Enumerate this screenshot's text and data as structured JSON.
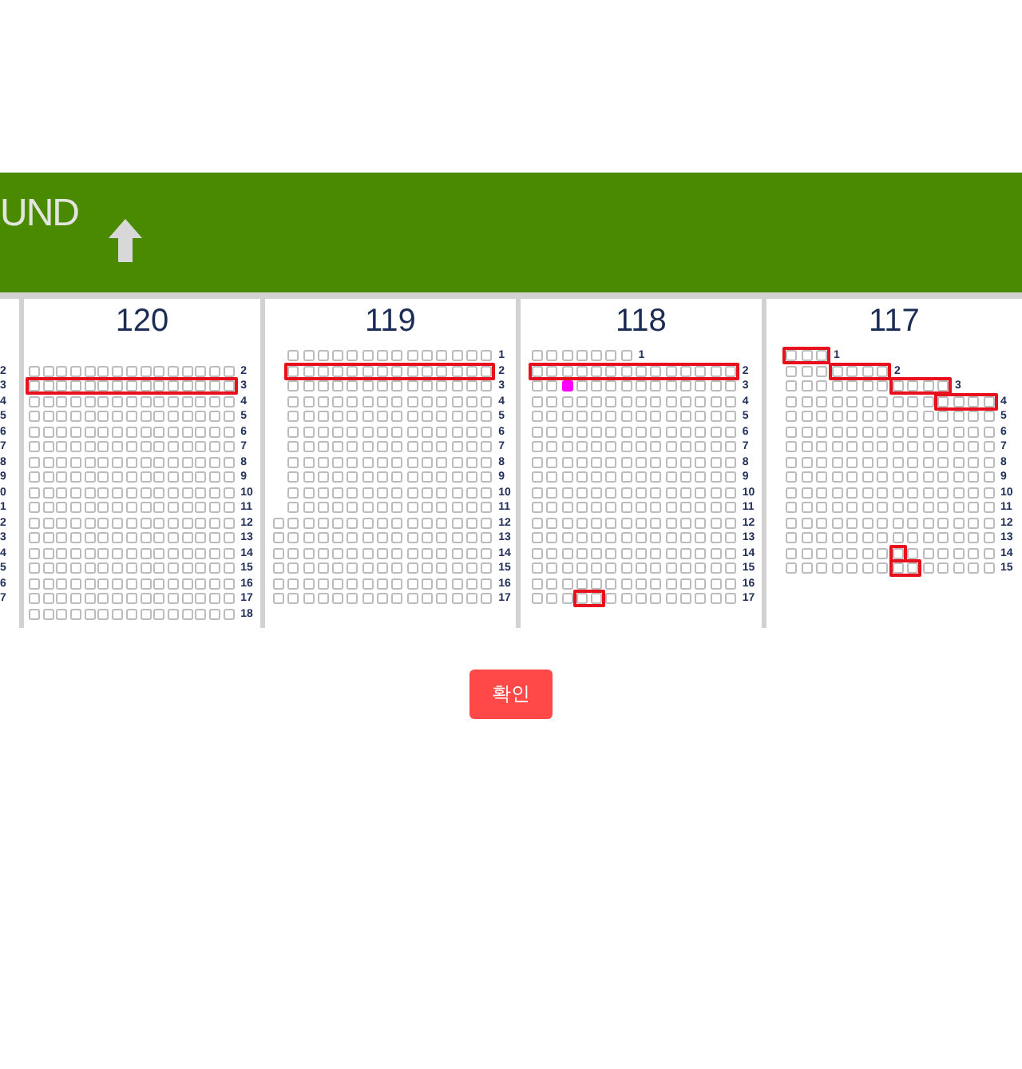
{
  "banner": {
    "text": "UND"
  },
  "sections": [
    {
      "kind": "edge",
      "rows": [
        {
          "label": "2"
        },
        {
          "label": "3"
        },
        {
          "label": "4"
        },
        {
          "label": "5"
        },
        {
          "label": "6"
        },
        {
          "label": "7"
        },
        {
          "label": "8"
        },
        {
          "label": "9"
        },
        {
          "label": "0"
        },
        {
          "label": "1"
        },
        {
          "label": "2"
        },
        {
          "label": "3"
        },
        {
          "label": "4"
        },
        {
          "label": "5"
        },
        {
          "label": "6"
        },
        {
          "label": "7"
        }
      ]
    },
    {
      "kind": "block",
      "title": "120",
      "rows": [
        {
          "label": "2",
          "highlighted": false,
          "marked": false
        },
        {
          "label": "3",
          "highlighted": true,
          "marked": false
        },
        {
          "label": "4",
          "highlighted": false,
          "marked": false
        },
        {
          "label": "5",
          "highlighted": false,
          "marked": false
        },
        {
          "label": "6",
          "highlighted": false,
          "marked": false
        },
        {
          "label": "7",
          "highlighted": false,
          "marked": false
        },
        {
          "label": "8",
          "highlighted": false,
          "marked": false
        },
        {
          "label": "9",
          "highlighted": false,
          "marked": false
        },
        {
          "label": "10",
          "highlighted": false,
          "marked": false
        },
        {
          "label": "11",
          "highlighted": false,
          "marked": false
        },
        {
          "label": "12",
          "highlighted": false,
          "marked": false
        },
        {
          "label": "13",
          "highlighted": false,
          "marked": false
        },
        {
          "label": "14",
          "highlighted": false,
          "marked": false
        },
        {
          "label": "15",
          "highlighted": false,
          "marked": false
        },
        {
          "label": "16",
          "highlighted": false,
          "marked": false
        },
        {
          "label": "17",
          "highlighted": false,
          "marked": false
        },
        {
          "label": "18",
          "highlighted": false,
          "marked": false
        }
      ]
    },
    {
      "kind": "block",
      "title": "119",
      "rows": [
        {
          "label": "1",
          "highlighted": false,
          "marked": false
        },
        {
          "label": "2",
          "highlighted": true,
          "marked": false
        },
        {
          "label": "3",
          "highlighted": false,
          "marked": false
        },
        {
          "label": "4",
          "highlighted": false,
          "marked": false
        },
        {
          "label": "5",
          "highlighted": false,
          "marked": false
        },
        {
          "label": "6",
          "highlighted": false,
          "marked": false
        },
        {
          "label": "7",
          "highlighted": false,
          "marked": false
        },
        {
          "label": "8",
          "highlighted": false,
          "marked": false
        },
        {
          "label": "9",
          "highlighted": false,
          "marked": false
        },
        {
          "label": "10",
          "highlighted": false,
          "marked": false
        },
        {
          "label": "11",
          "highlighted": false,
          "marked": false
        },
        {
          "label": "12",
          "highlighted": false,
          "marked": false
        },
        {
          "label": "13",
          "highlighted": false,
          "marked": false
        },
        {
          "label": "14",
          "highlighted": false,
          "marked": false
        },
        {
          "label": "15",
          "highlighted": false,
          "marked": false
        },
        {
          "label": "16",
          "highlighted": false,
          "marked": false
        },
        {
          "label": "17",
          "highlighted": false,
          "marked": false
        }
      ]
    },
    {
      "kind": "block",
      "title": "118",
      "rows": [
        {
          "label": "1",
          "highlighted": false,
          "marked": false
        },
        {
          "label": "2",
          "highlighted": true,
          "marked": false
        },
        {
          "label": "3",
          "highlighted": false,
          "marked": true
        },
        {
          "label": "4",
          "highlighted": false,
          "marked": false
        },
        {
          "label": "5",
          "highlighted": false,
          "marked": false
        },
        {
          "label": "6",
          "highlighted": false,
          "marked": false
        },
        {
          "label": "7",
          "highlighted": false,
          "marked": false
        },
        {
          "label": "8",
          "highlighted": false,
          "marked": false
        },
        {
          "label": "9",
          "highlighted": false,
          "marked": false
        },
        {
          "label": "10",
          "highlighted": false,
          "marked": false
        },
        {
          "label": "11",
          "highlighted": false,
          "marked": false
        },
        {
          "label": "12",
          "highlighted": false,
          "marked": false
        },
        {
          "label": "13",
          "highlighted": false,
          "marked": false
        },
        {
          "label": "14",
          "highlighted": false,
          "marked": false
        },
        {
          "label": "15",
          "highlighted": false,
          "marked": false
        },
        {
          "label": "16",
          "highlighted": false,
          "marked": false
        },
        {
          "label": "17",
          "highlighted": true,
          "marked": false
        }
      ]
    },
    {
      "kind": "block",
      "title": "117",
      "rows": [
        {
          "label": "1",
          "highlighted": true,
          "marked": false
        },
        {
          "label": "2",
          "highlighted": true,
          "marked": false
        },
        {
          "label": "3",
          "highlighted": true,
          "marked": false
        },
        {
          "label": "4",
          "highlighted": true,
          "marked": false
        },
        {
          "label": "5",
          "highlighted": false,
          "marked": false
        },
        {
          "label": "6",
          "highlighted": false,
          "marked": false
        },
        {
          "label": "7",
          "highlighted": false,
          "marked": false
        },
        {
          "label": "8",
          "highlighted": false,
          "marked": false
        },
        {
          "label": "9",
          "highlighted": false,
          "marked": false
        },
        {
          "label": "10",
          "highlighted": false,
          "marked": false
        },
        {
          "label": "11",
          "highlighted": false,
          "marked": false
        },
        {
          "label": "12",
          "highlighted": false,
          "marked": false
        },
        {
          "label": "13",
          "highlighted": false,
          "marked": false
        },
        {
          "label": "14",
          "highlighted": true,
          "marked": false
        },
        {
          "label": "15",
          "highlighted": true,
          "marked": false
        }
      ]
    }
  ],
  "confirm_button": {
    "label": "확인"
  }
}
